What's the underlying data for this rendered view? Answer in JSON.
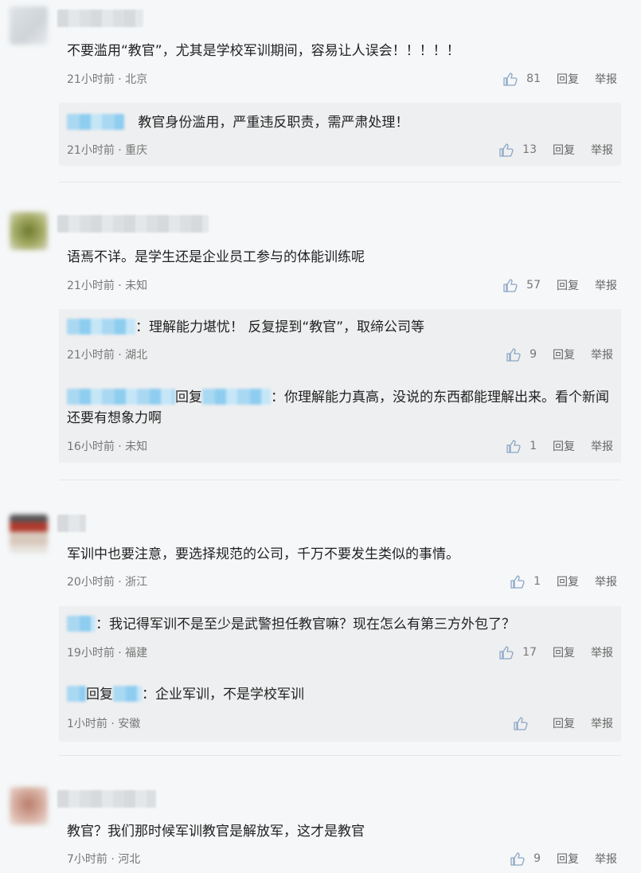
{
  "labels": {
    "reply": "回复",
    "report": "举报"
  },
  "comments": [
    {
      "text": "不要滥用“教官”，尤其是学校军训期间，容易让人误会！！！！！",
      "time": "21小时前 · 北京",
      "likes": "81",
      "replies": [
        {
          "text": "教官身份滥用，严重违反职责，需严肃处理！",
          "time": "21小时前 · 重庆",
          "likes": "13"
        }
      ]
    },
    {
      "text": "语焉不详。是学生还是企业员工参与的体能训练呢",
      "time": "21小时前 · 未知",
      "likes": "57",
      "replies": [
        {
          "text": "：理解能力堪忧！ 反复提到“教官”，取缔公司等",
          "time": "21小时前 · 湖北",
          "likes": "9"
        },
        {
          "reply_word": "回复",
          "text": "：你理解能力真高，没说的东西都能理解出来。看个新闻还要有想象力啊",
          "time": "16小时前 · 未知",
          "likes": "1"
        }
      ]
    },
    {
      "text": "军训中也要注意，要选择规范的公司，千万不要发生类似的事情。",
      "time": "20小时前 · 浙江",
      "likes": "1",
      "replies": [
        {
          "text": "：我记得军训不是至少是武警担任教官嘛？现在怎么有第三方外包了？",
          "time": "19小时前 · 福建",
          "likes": "17"
        },
        {
          "reply_word": "回复",
          "text": "：企业军训，不是学校军训",
          "time": "1小时前 · 安徽",
          "likes": ""
        }
      ]
    },
    {
      "text": "教官？我们那时候军训教官是解放军，这才是教官",
      "time": "7小时前 · 河北",
      "likes": "9",
      "replies": []
    }
  ]
}
